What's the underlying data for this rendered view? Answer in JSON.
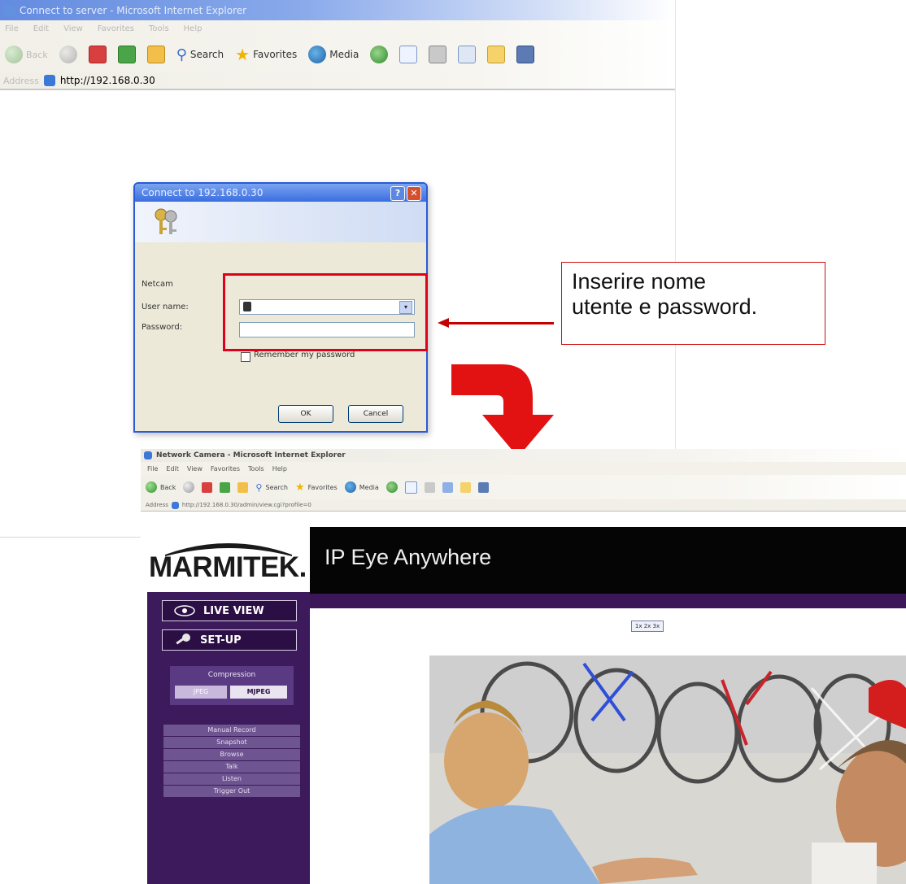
{
  "top_window": {
    "title": "Connect to server - Microsoft Internet Explorer",
    "menu": [
      "File",
      "Edit",
      "View",
      "Favorites",
      "Tools",
      "Help"
    ],
    "toolbar": {
      "back": "Back",
      "search": "Search",
      "favorites": "Favorites",
      "media": "Media"
    },
    "address_label": "Address",
    "address_value": "http://192.168.0.30"
  },
  "login_dialog": {
    "title": "Connect to 192.168.0.30",
    "realm": "Netcam",
    "username_label": "User name:",
    "password_label": "Password:",
    "remember_label": "Remember my password",
    "ok_label": "OK",
    "cancel_label": "Cancel"
  },
  "callout": {
    "line1": "Inserire nome",
    "line2": "utente e password."
  },
  "bottom_window": {
    "title": "Network Camera - Microsoft Internet Explorer",
    "menu": [
      "File",
      "Edit",
      "View",
      "Favorites",
      "Tools",
      "Help"
    ],
    "toolbar": {
      "back": "Back",
      "search": "Search",
      "favorites": "Favorites",
      "media": "Media"
    },
    "address_label": "Address",
    "address_value": "http://192.168.0.30/admin/view.cgi?profile=0"
  },
  "camera_page": {
    "brand": "MARMITEK.",
    "header_title": "IP Eye Anywhere",
    "live_view": "LIVE VIEW",
    "setup": "SET-UP",
    "compression_label": "Compression",
    "compression_options": [
      "JPEG",
      "MJPEG"
    ],
    "actions": [
      "Manual Record",
      "Snapshot",
      "Browse",
      "Talk",
      "Listen",
      "Trigger Out"
    ],
    "zoom_control": "1x 2x 3x"
  },
  "colors": {
    "highlight_red": "#e0001a",
    "sidebar_purple": "#3c1a5c",
    "header_black": "#050505"
  }
}
